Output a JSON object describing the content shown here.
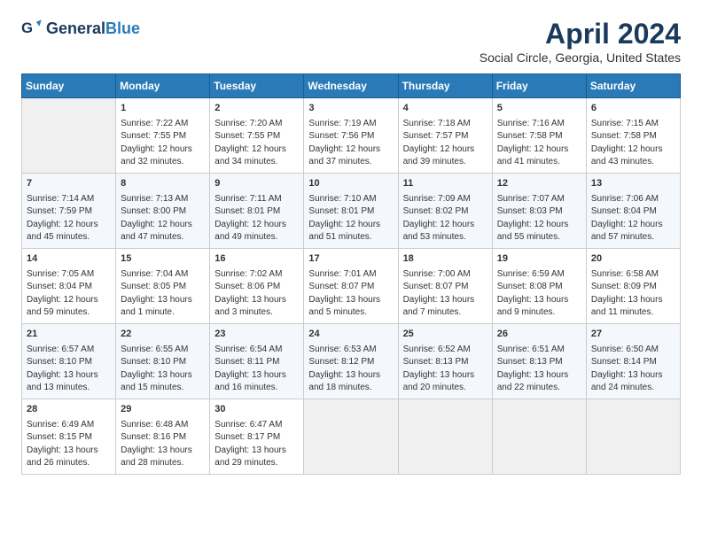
{
  "header": {
    "logo_general": "General",
    "logo_blue": "Blue",
    "month": "April 2024",
    "location": "Social Circle, Georgia, United States"
  },
  "weekdays": [
    "Sunday",
    "Monday",
    "Tuesday",
    "Wednesday",
    "Thursday",
    "Friday",
    "Saturday"
  ],
  "weeks": [
    [
      {
        "day": "",
        "empty": true
      },
      {
        "day": "1",
        "sunrise": "7:22 AM",
        "sunset": "7:55 PM",
        "daylight": "12 hours and 32 minutes."
      },
      {
        "day": "2",
        "sunrise": "7:20 AM",
        "sunset": "7:55 PM",
        "daylight": "12 hours and 34 minutes."
      },
      {
        "day": "3",
        "sunrise": "7:19 AM",
        "sunset": "7:56 PM",
        "daylight": "12 hours and 37 minutes."
      },
      {
        "day": "4",
        "sunrise": "7:18 AM",
        "sunset": "7:57 PM",
        "daylight": "12 hours and 39 minutes."
      },
      {
        "day": "5",
        "sunrise": "7:16 AM",
        "sunset": "7:58 PM",
        "daylight": "12 hours and 41 minutes."
      },
      {
        "day": "6",
        "sunrise": "7:15 AM",
        "sunset": "7:58 PM",
        "daylight": "12 hours and 43 minutes."
      }
    ],
    [
      {
        "day": "7",
        "sunrise": "7:14 AM",
        "sunset": "7:59 PM",
        "daylight": "12 hours and 45 minutes."
      },
      {
        "day": "8",
        "sunrise": "7:13 AM",
        "sunset": "8:00 PM",
        "daylight": "12 hours and 47 minutes."
      },
      {
        "day": "9",
        "sunrise": "7:11 AM",
        "sunset": "8:01 PM",
        "daylight": "12 hours and 49 minutes."
      },
      {
        "day": "10",
        "sunrise": "7:10 AM",
        "sunset": "8:01 PM",
        "daylight": "12 hours and 51 minutes."
      },
      {
        "day": "11",
        "sunrise": "7:09 AM",
        "sunset": "8:02 PM",
        "daylight": "12 hours and 53 minutes."
      },
      {
        "day": "12",
        "sunrise": "7:07 AM",
        "sunset": "8:03 PM",
        "daylight": "12 hours and 55 minutes."
      },
      {
        "day": "13",
        "sunrise": "7:06 AM",
        "sunset": "8:04 PM",
        "daylight": "12 hours and 57 minutes."
      }
    ],
    [
      {
        "day": "14",
        "sunrise": "7:05 AM",
        "sunset": "8:04 PM",
        "daylight": "12 hours and 59 minutes."
      },
      {
        "day": "15",
        "sunrise": "7:04 AM",
        "sunset": "8:05 PM",
        "daylight": "13 hours and 1 minute."
      },
      {
        "day": "16",
        "sunrise": "7:02 AM",
        "sunset": "8:06 PM",
        "daylight": "13 hours and 3 minutes."
      },
      {
        "day": "17",
        "sunrise": "7:01 AM",
        "sunset": "8:07 PM",
        "daylight": "13 hours and 5 minutes."
      },
      {
        "day": "18",
        "sunrise": "7:00 AM",
        "sunset": "8:07 PM",
        "daylight": "13 hours and 7 minutes."
      },
      {
        "day": "19",
        "sunrise": "6:59 AM",
        "sunset": "8:08 PM",
        "daylight": "13 hours and 9 minutes."
      },
      {
        "day": "20",
        "sunrise": "6:58 AM",
        "sunset": "8:09 PM",
        "daylight": "13 hours and 11 minutes."
      }
    ],
    [
      {
        "day": "21",
        "sunrise": "6:57 AM",
        "sunset": "8:10 PM",
        "daylight": "13 hours and 13 minutes."
      },
      {
        "day": "22",
        "sunrise": "6:55 AM",
        "sunset": "8:10 PM",
        "daylight": "13 hours and 15 minutes."
      },
      {
        "day": "23",
        "sunrise": "6:54 AM",
        "sunset": "8:11 PM",
        "daylight": "13 hours and 16 minutes."
      },
      {
        "day": "24",
        "sunrise": "6:53 AM",
        "sunset": "8:12 PM",
        "daylight": "13 hours and 18 minutes."
      },
      {
        "day": "25",
        "sunrise": "6:52 AM",
        "sunset": "8:13 PM",
        "daylight": "13 hours and 20 minutes."
      },
      {
        "day": "26",
        "sunrise": "6:51 AM",
        "sunset": "8:13 PM",
        "daylight": "13 hours and 22 minutes."
      },
      {
        "day": "27",
        "sunrise": "6:50 AM",
        "sunset": "8:14 PM",
        "daylight": "13 hours and 24 minutes."
      }
    ],
    [
      {
        "day": "28",
        "sunrise": "6:49 AM",
        "sunset": "8:15 PM",
        "daylight": "13 hours and 26 minutes."
      },
      {
        "day": "29",
        "sunrise": "6:48 AM",
        "sunset": "8:16 PM",
        "daylight": "13 hours and 28 minutes."
      },
      {
        "day": "30",
        "sunrise": "6:47 AM",
        "sunset": "8:17 PM",
        "daylight": "13 hours and 29 minutes."
      },
      {
        "day": "",
        "empty": true
      },
      {
        "day": "",
        "empty": true
      },
      {
        "day": "",
        "empty": true
      },
      {
        "day": "",
        "empty": true
      }
    ]
  ]
}
